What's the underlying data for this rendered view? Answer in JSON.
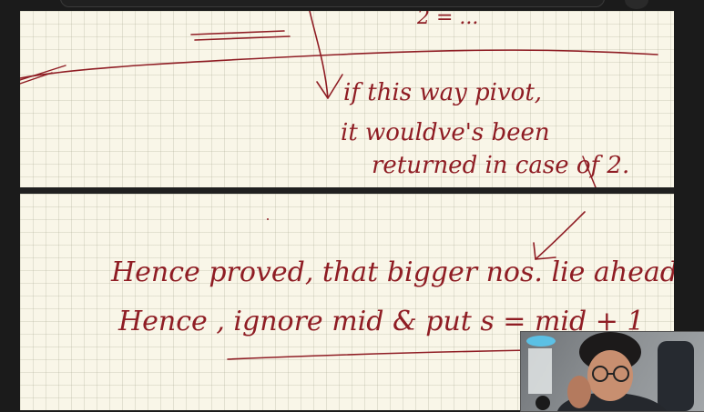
{
  "page_top": {
    "lines": [
      "if this way pivot,",
      "it wouldve's been",
      "returned in case of 2."
    ],
    "partial_top_text": "2 = ..."
  },
  "page_bottom": {
    "lines": [
      "Hence proved, that bigger nos. lie ahead.",
      "Hence , ignore mid & put s = mid + 1"
    ]
  },
  "webcam": {
    "icon": "person-video-icon"
  }
}
